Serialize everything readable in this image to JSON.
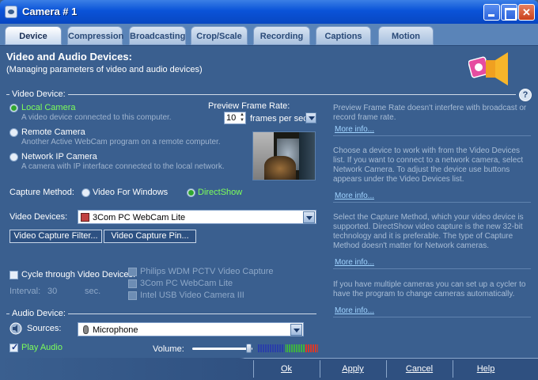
{
  "window": {
    "title": "Camera # 1"
  },
  "tabs": [
    {
      "label": "Device",
      "active": true
    },
    {
      "label": "Compression"
    },
    {
      "label": "Broadcasting"
    },
    {
      "label": "Crop/Scale"
    },
    {
      "label": "Recording"
    },
    {
      "label": "Captions"
    },
    {
      "label": "Motion"
    }
  ],
  "header": {
    "title": "Video and Audio Devices:",
    "subtitle": "(Managing parameters of video and audio devices)"
  },
  "video_device": {
    "section_label": "Video Device:",
    "options": [
      {
        "label": "Local Camera",
        "desc": "A video device connected to this computer.",
        "selected": true
      },
      {
        "label": "Remote Camera",
        "desc": "Another Active WebCam program on a remote computer."
      },
      {
        "label": "Network IP Camera",
        "desc": "A camera with IP interface connected to the local network."
      }
    ],
    "preview_rate_label": "Preview Frame Rate:",
    "preview_rate_value": "10",
    "preview_rate_unit": "frames per sec.",
    "capture_method_label": "Capture Method:",
    "capture_methods": [
      {
        "label": "Video For Windows"
      },
      {
        "label": "DirectShow",
        "selected": true
      }
    ],
    "devices_label": "Video Devices:",
    "devices_selected": "3Com PC WebCam Lite",
    "filter_button": "Video Capture Filter...",
    "pin_button": "Video Capture Pin...",
    "cycle_label": "Cycle through Video Devices:",
    "cycle_devices": [
      "Philips WDM PCTV Video Capture",
      "3Com PC WebCam Lite",
      "Intel USB Video Camera III"
    ],
    "interval_label": "Interval:",
    "interval_value": "30",
    "interval_unit": "sec."
  },
  "audio_device": {
    "section_label": "Audio Device:",
    "sources_label": "Sources:",
    "source_selected": "Microphone",
    "play_audio_label": "Play Audio",
    "volume_label": "Volume:",
    "volume_level": 0.95
  },
  "help_text": [
    {
      "text": "Preview Frame Rate doesn't interfere with broadcast or record frame rate.",
      "link": "More info..."
    },
    {
      "text": "Choose a device to work with from the Video Devices list. If you want to connect to a network camera, select Network Camera. To adjust the device use buttons appears under the Video Devices list.",
      "link": "More info..."
    },
    {
      "text": "Select the Capture Method, which your video device is supported. DirectShow video capture is the new 32-bit technology and it is preferable. The type of Capture Method doesn't matter for Network cameras.",
      "link": "More info..."
    },
    {
      "text": "If you have multiple cameras you can set up a cycler to have the program to change cameras automatically.",
      "link": "More info..."
    }
  ],
  "footer": {
    "ok": "Ok",
    "apply": "Apply",
    "cancel": "Cancel",
    "help": "Help"
  },
  "colors": {
    "background": "#3a5f8f",
    "accent_green": "#7dff5a",
    "link": "#9fd3ff"
  }
}
